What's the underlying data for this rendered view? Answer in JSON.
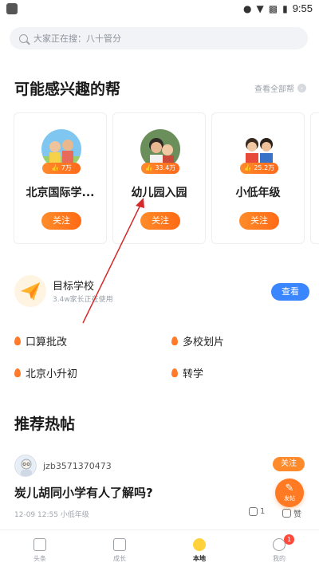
{
  "status_bar": {
    "time": "9:55"
  },
  "search": {
    "placeholder": "大家正在搜：八十管分"
  },
  "interest_section": {
    "title": "可能感兴趣的帮",
    "see_all": "查看全部帮"
  },
  "cards": [
    {
      "name": "北京国际学...",
      "count": "7万",
      "follow": "关注"
    },
    {
      "name": "幼儿园入园",
      "count": "33.4万",
      "follow": "关注"
    },
    {
      "name": "小低年级",
      "count": "25.2万",
      "follow": "关注"
    }
  ],
  "target_school": {
    "title": "目标学校",
    "subtitle": "3.4w家长正在使用",
    "button": "查看"
  },
  "tools": [
    "口算批改",
    "多校划片",
    "北京小升初",
    "转学"
  ],
  "hot_section": {
    "title": "推荐热帖"
  },
  "post": {
    "username": "jzb3571370473",
    "follow": "关注",
    "title": "炭儿胡同小学有人了解吗?",
    "meta": "12-09 12:55  小低年级",
    "comments": "1",
    "likes": "赞"
  },
  "fab": {
    "label": "发帖"
  },
  "tabbar": {
    "tabs": [
      {
        "label": "头条"
      },
      {
        "label": "成长"
      },
      {
        "label": "本地"
      },
      {
        "label": "我的",
        "badge": "1"
      }
    ],
    "active": "本地"
  },
  "colors": {
    "accent": "#ff7a22",
    "blue": "#3a86ff",
    "annotation_arrow": "#d42a2a"
  }
}
